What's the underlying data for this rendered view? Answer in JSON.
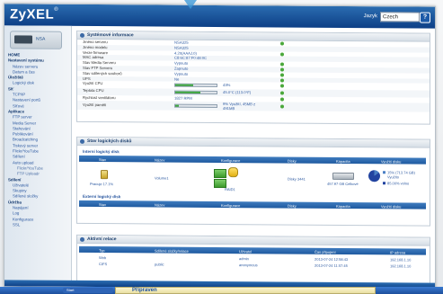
{
  "header": {
    "logo": "ZyXEL",
    "lang_label": "Jazyk",
    "lang_value": "Czech"
  },
  "sidebar": {
    "device_label": "NSA",
    "items": [
      {
        "level": 0,
        "label": "HOME"
      },
      {
        "level": 0,
        "label": "Nastavení systému"
      },
      {
        "level": 1,
        "label": "Název serveru"
      },
      {
        "level": 1,
        "label": "Datum a čas"
      },
      {
        "level": 0,
        "label": "Úložiště"
      },
      {
        "level": 1,
        "label": "Logický disk"
      },
      {
        "level": 0,
        "label": "Síť"
      },
      {
        "level": 1,
        "label": "TCP/IP"
      },
      {
        "level": 1,
        "label": "Nastavení portů"
      },
      {
        "level": 1,
        "label": "Síťové"
      },
      {
        "level": 0,
        "label": "Aplikace"
      },
      {
        "level": 1,
        "label": "FTP server"
      },
      {
        "level": 1,
        "label": "Media Server"
      },
      {
        "level": 1,
        "label": "Stahování"
      },
      {
        "level": 1,
        "label": "Publikování"
      },
      {
        "level": 1,
        "label": "Broadcatching"
      },
      {
        "level": 1,
        "label": "Tiskový server"
      },
      {
        "level": 1,
        "label": "Flickr/YouTube"
      },
      {
        "level": 1,
        "label": "Sdílení"
      },
      {
        "level": 1,
        "label": "Auto upload"
      },
      {
        "level": 2,
        "label": "Flickr/YouTube"
      },
      {
        "level": 2,
        "label": "FTP Uploadr"
      },
      {
        "level": 0,
        "label": "Sdílení"
      },
      {
        "level": 1,
        "label": "Uživatelé"
      },
      {
        "level": 1,
        "label": "Skupiny"
      },
      {
        "level": 1,
        "label": "Sdílené složky"
      },
      {
        "level": 0,
        "label": "Údržba"
      },
      {
        "level": 1,
        "label": "Napájení"
      },
      {
        "level": 1,
        "label": "Log"
      },
      {
        "level": 1,
        "label": "Konfigurace"
      },
      {
        "level": 1,
        "label": "SSL"
      }
    ]
  },
  "system_panel": {
    "title": "Systémové informace",
    "rows": [
      {
        "label": "Jméno serveru",
        "value": "NSA325",
        "check": true
      },
      {
        "label": "Jméno modelu",
        "value": "NSA325",
        "check": false
      },
      {
        "label": "Verze firmware",
        "value": "4.20(AAAJ.0)",
        "check": true
      },
      {
        "label": "MAC adresa",
        "value": "C8:6C:87:F0:48:0C",
        "check": false
      },
      {
        "label": "Stav Media Serveru",
        "value": "Vypnuto",
        "check": true
      },
      {
        "label": "Stav FTP Serveru",
        "value": "Zapnuto",
        "check": true
      },
      {
        "label": "Stav sdílených souborů",
        "value": "Vypnuto",
        "check": true
      },
      {
        "label": "UPS",
        "value": "Ne",
        "check": true
      }
    ],
    "cpu": {
      "label": "Využití CPU",
      "percent": 43,
      "text": "43%",
      "check": true
    },
    "temp": {
      "label": "Teplota CPU",
      "percent": 60,
      "text": "45.0°C (113.0°F)",
      "check": true
    },
    "fan": {
      "label": "Rychlost ventilátoru",
      "value": "1827 RPM",
      "check": true
    },
    "mem": {
      "label": "Využití paměti",
      "percent": 9,
      "text": "9% Využití, 45MB z 491MB",
      "check": true
    }
  },
  "volume_panel": {
    "title": "Stav logických disků",
    "internal_title": "Interní logický disk",
    "external_title": "Externí logický disk",
    "headers": [
      "Stav",
      "Název",
      "Konfigurace",
      "Disky",
      "Kapacita",
      "Využití disku"
    ],
    "row": {
      "status": "Pracuje 17.1%",
      "name": "Volume1",
      "config": "RAID1",
      "disks": "Disky 3441",
      "capacity": "457.97 GB Celkové",
      "usage_pct": 15,
      "usage_used": "15% (713.74 GB) Využito",
      "usage_free": "85.00% volno"
    }
  },
  "session_panel": {
    "title": "Aktivní relace",
    "headers": [
      "Typ",
      "Sdílené složky/relace",
      "Uživatel",
      "Čas připojení",
      "IP adresa"
    ],
    "rows": [
      {
        "type": "Web",
        "share": "",
        "user": "admin",
        "time": "2013-07-24 12:58:43",
        "ip": "192.168.1.10"
      },
      {
        "type": "CIFS",
        "share": "public",
        "user": "anonymous",
        "time": "2013-07-24 11:07:45",
        "ip": "192.168.1.10"
      }
    ]
  },
  "taskbar": {
    "start_label": "Start",
    "task_label": "Připraven"
  },
  "colors": {
    "header": "#0d3f86",
    "accent": "#2b58a0",
    "ok": "#4aa83b"
  }
}
